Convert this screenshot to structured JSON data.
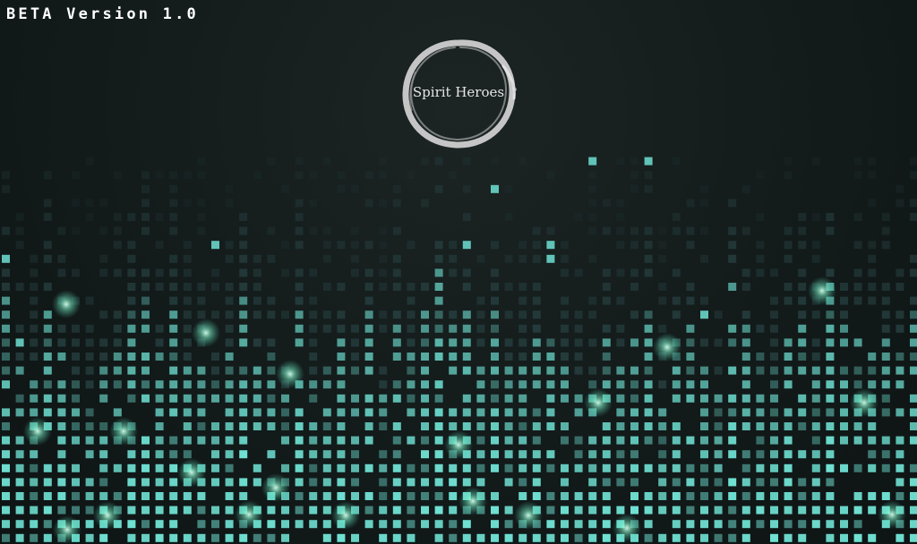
{
  "screen": {
    "version_label": "BETA Version 1.0",
    "logo_text": "Spirit Heroes"
  },
  "colors": {
    "background": "#111818",
    "tile_bright": "#6fe0d2",
    "tile_dim": "#1f3232",
    "glow": "#b6ffe0",
    "logo_ring": "#d8d8d8",
    "text": "#ffffff"
  }
}
